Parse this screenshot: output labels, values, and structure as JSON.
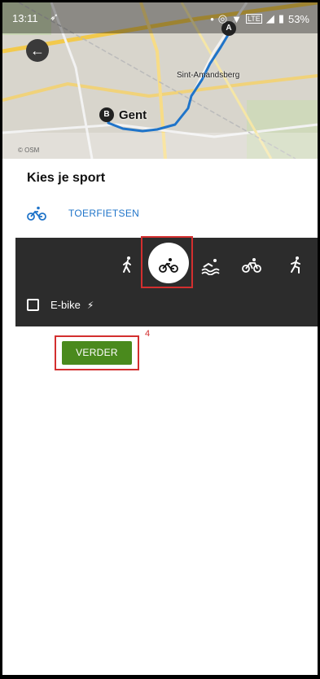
{
  "status_bar": {
    "time": "13:11",
    "battery": "53%",
    "icons": [
      "location-arrow-icon",
      "gps-icon",
      "wifi-icon",
      "volte-icon",
      "signal-icon",
      "battery-icon"
    ]
  },
  "map": {
    "city_label": "Gent",
    "district_label": "Sint-Amandsberg",
    "attribution": "© OSM",
    "start_marker": "A",
    "end_marker": "B",
    "route_color": "#1f74c9"
  },
  "sport_picker": {
    "title": "Kies je sport",
    "selected_sport": "TOERFIETSEN",
    "sports": [
      {
        "name": "walking",
        "icon": "walking-icon",
        "selected": false
      },
      {
        "name": "touring-bike",
        "icon": "bike-icon",
        "selected": true
      },
      {
        "name": "swimming",
        "icon": "swimming-icon",
        "selected": false
      },
      {
        "name": "road-bike",
        "icon": "road-bike-icon",
        "selected": false
      },
      {
        "name": "running",
        "icon": "running-icon",
        "selected": false
      }
    ],
    "ebike_label": "E-bike",
    "ebike_checked": false
  },
  "actions": {
    "continue_label": "VERDER",
    "annotation_number": "4"
  },
  "colors": {
    "accent": "#1f74c9",
    "panel": "#2c2c2c",
    "button": "#4a8a1d",
    "highlight": "#d32f2f"
  }
}
